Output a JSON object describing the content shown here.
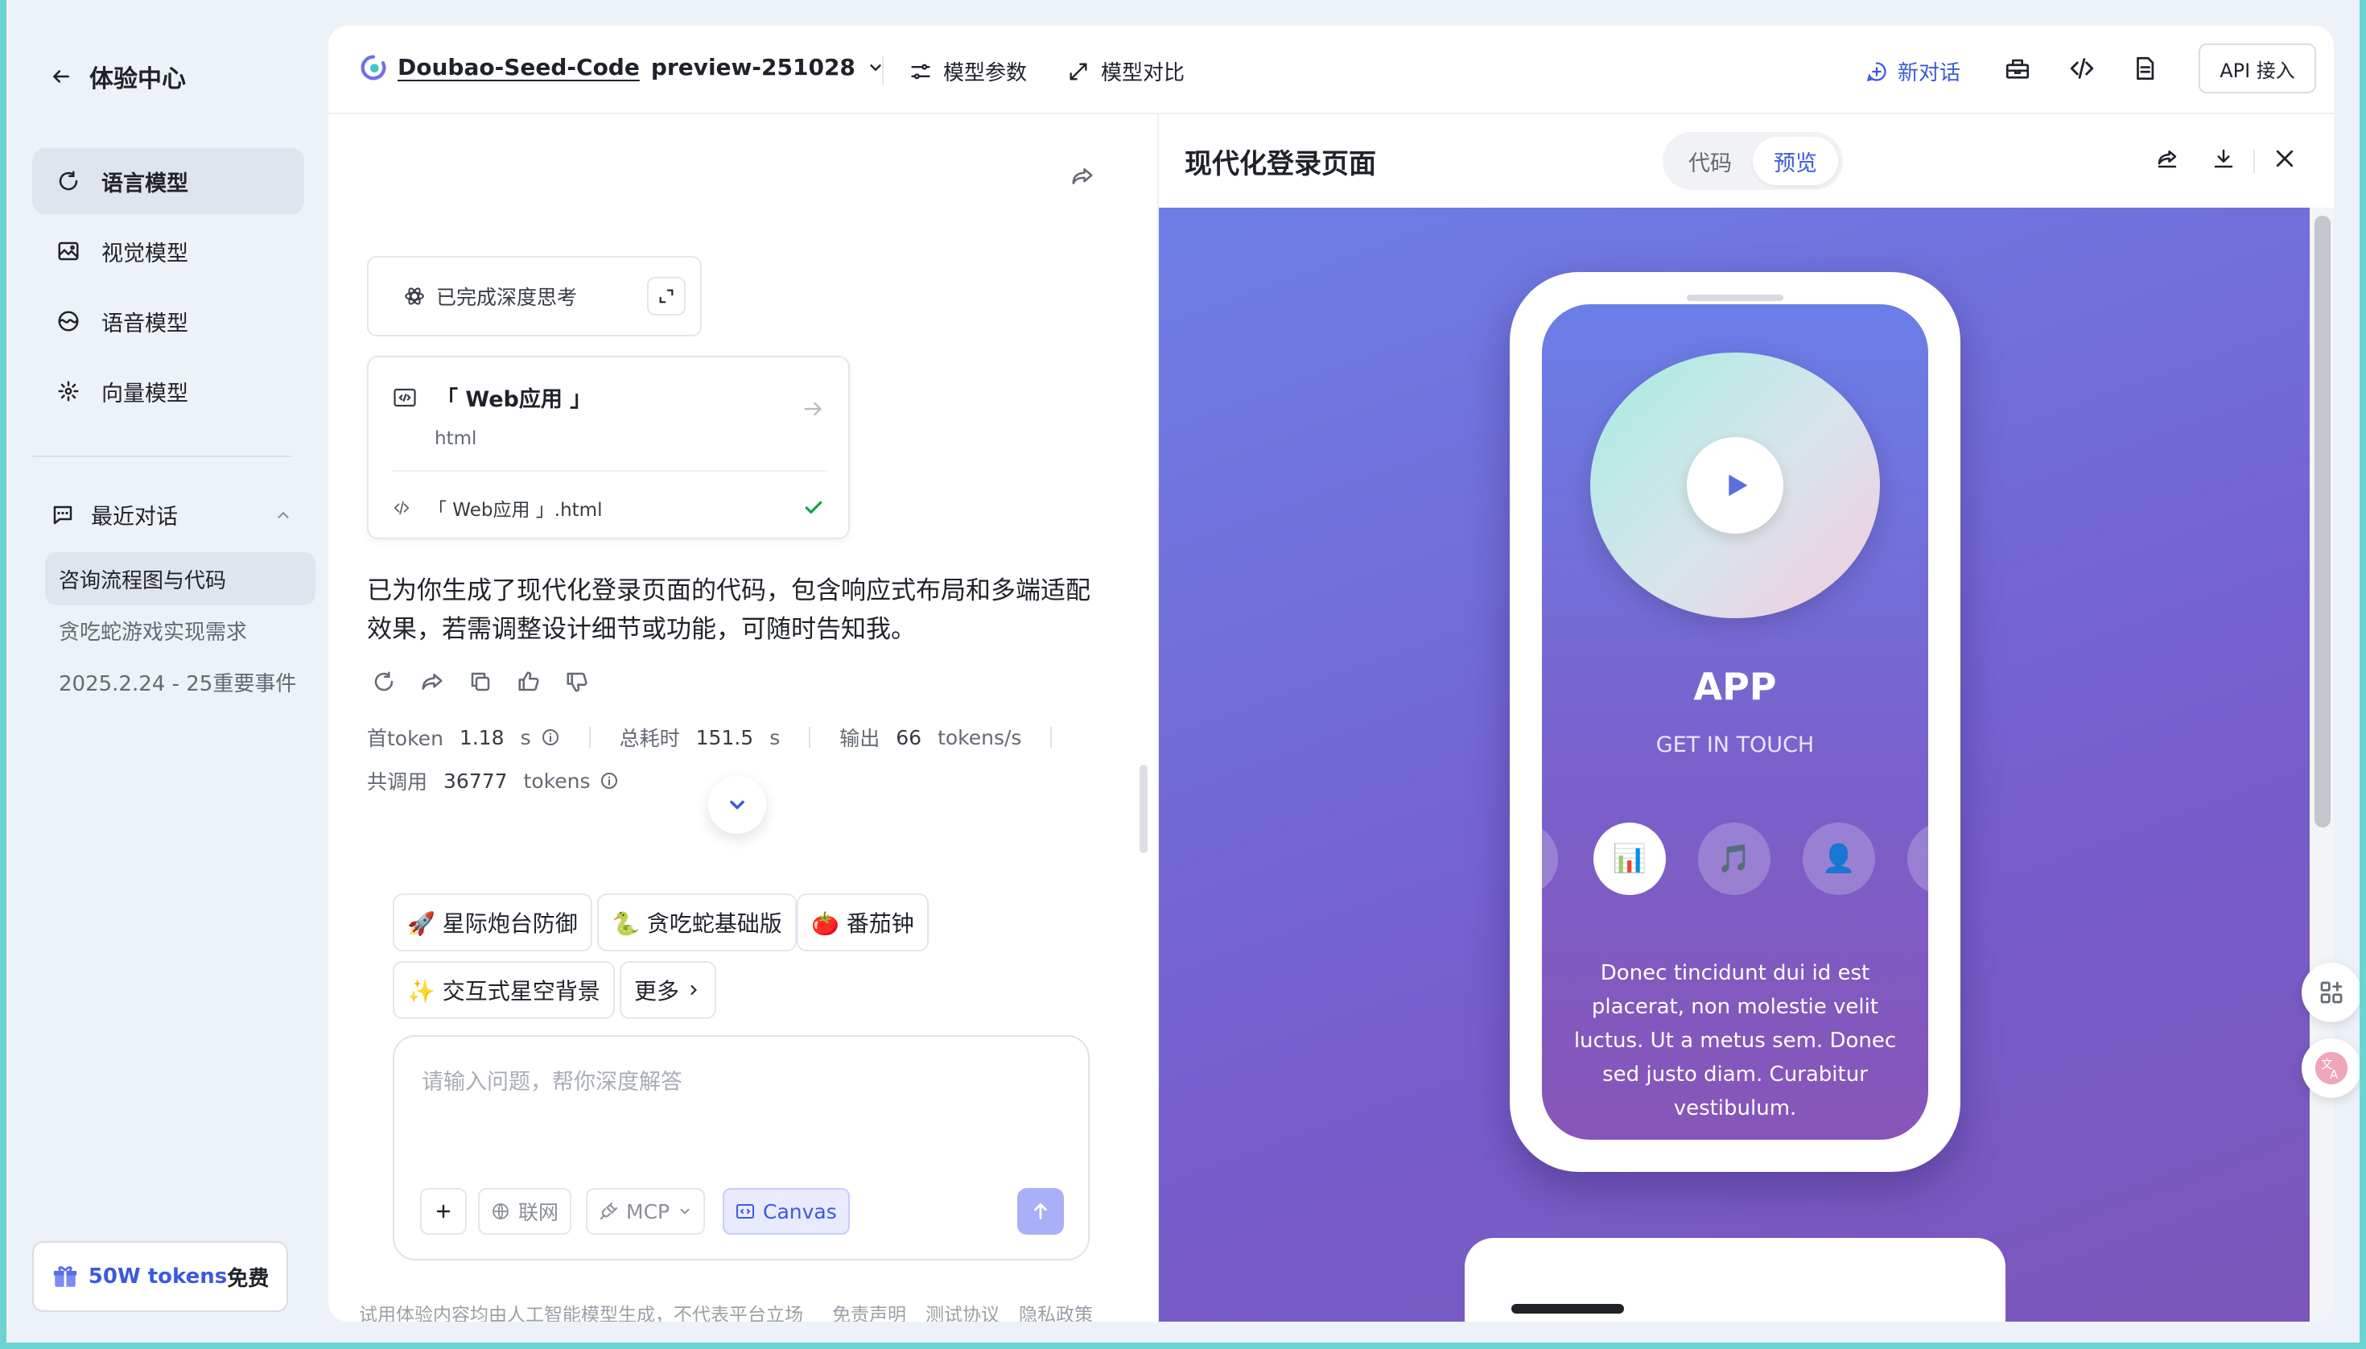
{
  "sidebar": {
    "back_label": "体验中心",
    "nav": [
      {
        "label": "语言模型",
        "icon": "refresh-loop-icon",
        "active": true
      },
      {
        "label": "视觉模型",
        "icon": "image-icon",
        "active": false
      },
      {
        "label": "语音模型",
        "icon": "audio-wave-icon",
        "active": false
      },
      {
        "label": "向量模型",
        "icon": "vector-dots-icon",
        "active": false
      }
    ],
    "recent_title": "最近对话",
    "recent": [
      "咨询流程图与代码",
      "贪吃蛇游戏实现需求",
      "2025.2.24 - 25重要事件"
    ],
    "promo": {
      "highlight": "50W tokens",
      "suffix": "免费"
    }
  },
  "topbar": {
    "model_name": "Doubao-Seed-Code",
    "model_version": "preview-251028",
    "params_label": "模型参数",
    "compare_label": "模型对比",
    "new_chat_label": "新对话",
    "api_label": "API 接入"
  },
  "chat": {
    "thinking_label": "已完成深度思考",
    "artifact": {
      "title": "「 Web应用 」",
      "lang": "html",
      "file": "「 Web应用 」.html"
    },
    "answer": "已为你生成了现代化登录页面的代码，包含响应式布局和多端适配效果，若需调整设计细节或功能，可随时告知我。",
    "stats": {
      "first_token_label": "首token",
      "first_token_value": "1.18",
      "first_token_unit": "s",
      "total_label": "总耗时",
      "total_value": "151.5",
      "total_unit": "s",
      "output_label": "输出",
      "output_value": "66",
      "output_unit": "tokens/s",
      "usage_label": "共调用",
      "usage_value": "36777",
      "usage_unit": "tokens"
    },
    "suggestions": [
      "🚀 星际炮台防御",
      "🐍 贪吃蛇基础版",
      "🍅 番茄钟",
      "✨ 交互式星空背景"
    ],
    "more_label": "更多",
    "input_placeholder": "请输入问题，帮你深度解答",
    "tools": {
      "web": "联网",
      "mcp": "MCP",
      "canvas": "Canvas"
    },
    "footer": [
      "试用体验内容均由人工智能模型生成，不代表平台立场",
      "免责声明",
      "测试协议",
      "隐私政策"
    ]
  },
  "preview": {
    "title": "现代化登录页面",
    "tab_code": "代码",
    "tab_preview": "预览",
    "app_title": "APP",
    "app_subtitle": "GET IN TOUCH",
    "icons": [
      "🌍",
      "📊",
      "🎵",
      "👤",
      "📁"
    ],
    "body_text": "Donec tincidunt dui id est placerat, non molestie velit luctus. Ut a metus sem. Donec sed justo diam. Curabitur vestibulum."
  },
  "colors": {
    "accent": "#3b5bdb",
    "preview_bg": "#7560cf",
    "frame": "#6cd3d3"
  }
}
